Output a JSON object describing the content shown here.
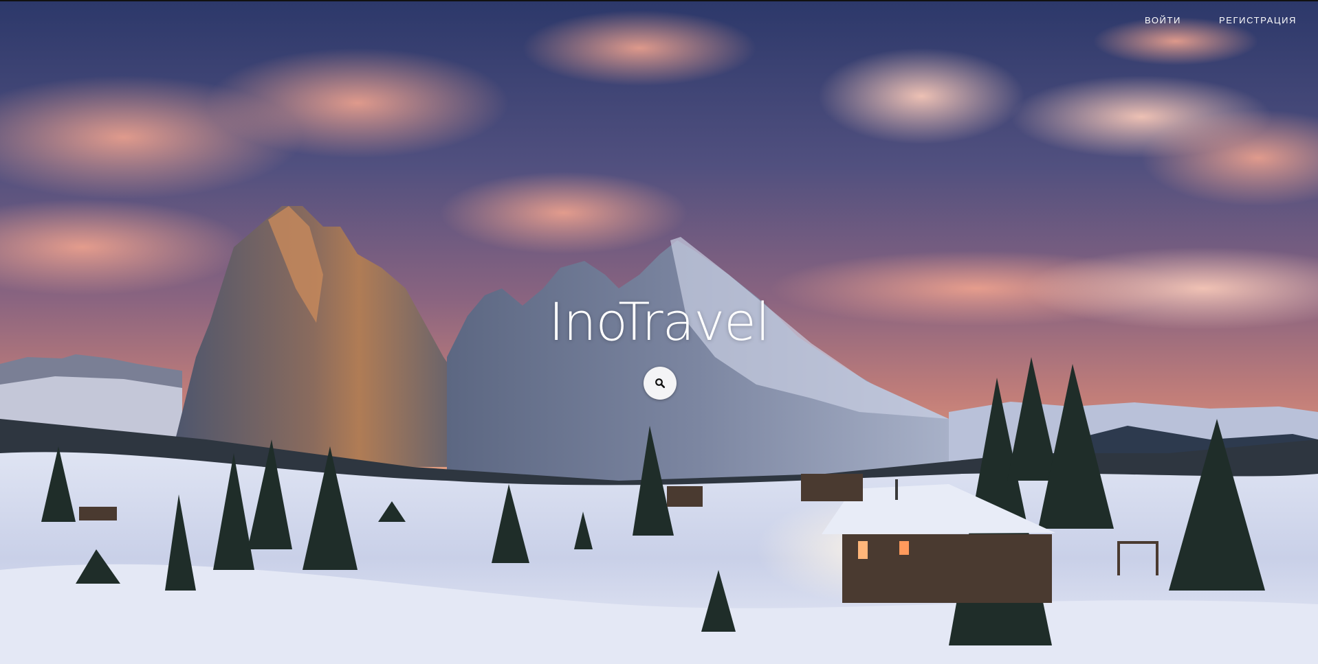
{
  "nav": {
    "login_label": "ВОЙТИ",
    "register_label": "РЕГИСТРАЦИЯ"
  },
  "hero": {
    "title": "InoTravel",
    "search_icon": "search-icon",
    "background": "snowy-mountain-sunset-photo"
  },
  "colors": {
    "sky_top": "#2f3b6c",
    "sky_glow": "#e59a86",
    "snow": "#e8ecf7",
    "text": "#ffffff",
    "search_button": "#f4f4f6"
  }
}
